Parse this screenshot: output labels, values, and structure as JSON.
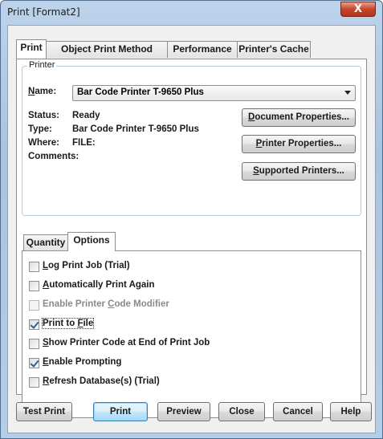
{
  "window": {
    "title": "Print [Format2]",
    "close_glyph": "X"
  },
  "tabs": [
    {
      "label": "Print"
    },
    {
      "label": "Object Print Method"
    },
    {
      "label": "Performance"
    },
    {
      "label": "Printer's Cache"
    }
  ],
  "printer": {
    "group_title": "Printer",
    "name_label_u": "N",
    "name_label_rest": "ame:",
    "name_value": "Bar Code Printer T-9650 Plus",
    "status_label": "Status:",
    "status_value": "Ready",
    "type_label": "Type:",
    "type_value": "Bar Code Printer T-9650 Plus",
    "where_label": "Where:",
    "where_value": "FILE:",
    "comments_label": "Comments:",
    "doc_props_u": "D",
    "doc_props_rest": "ocument Properties...",
    "printer_props_u": "P",
    "printer_props_rest": "rinter Properties...",
    "supported_u": "S",
    "supported_rest": "upported Printers..."
  },
  "inner_tabs": [
    {
      "label": "Quantity"
    },
    {
      "label": "Options"
    }
  ],
  "options": [
    {
      "pre": "",
      "u": "L",
      "post": "og Print Job (Trial)",
      "checked": false,
      "disabled": false
    },
    {
      "pre": "",
      "u": "A",
      "post": "utomatically Print Again",
      "checked": false,
      "disabled": false
    },
    {
      "pre": "Enable Printer ",
      "u": "C",
      "post": "ode Modifier",
      "checked": false,
      "disabled": true
    },
    {
      "pre": "Print to ",
      "u": "F",
      "post": "ile",
      "checked": true,
      "disabled": false
    },
    {
      "pre": "",
      "u": "S",
      "post": "how Printer Code at End of Print Job",
      "checked": false,
      "disabled": false
    },
    {
      "pre": "",
      "u": "E",
      "post": "nable Prompting",
      "checked": true,
      "disabled": false
    },
    {
      "pre": "",
      "u": "R",
      "post": "efresh Database(s) (Trial)",
      "checked": false,
      "disabled": false
    }
  ],
  "footer": {
    "test_print": "Test Print",
    "print": "Print",
    "preview": "Preview",
    "close": "Close",
    "cancel": "Cancel",
    "help": "Help"
  }
}
